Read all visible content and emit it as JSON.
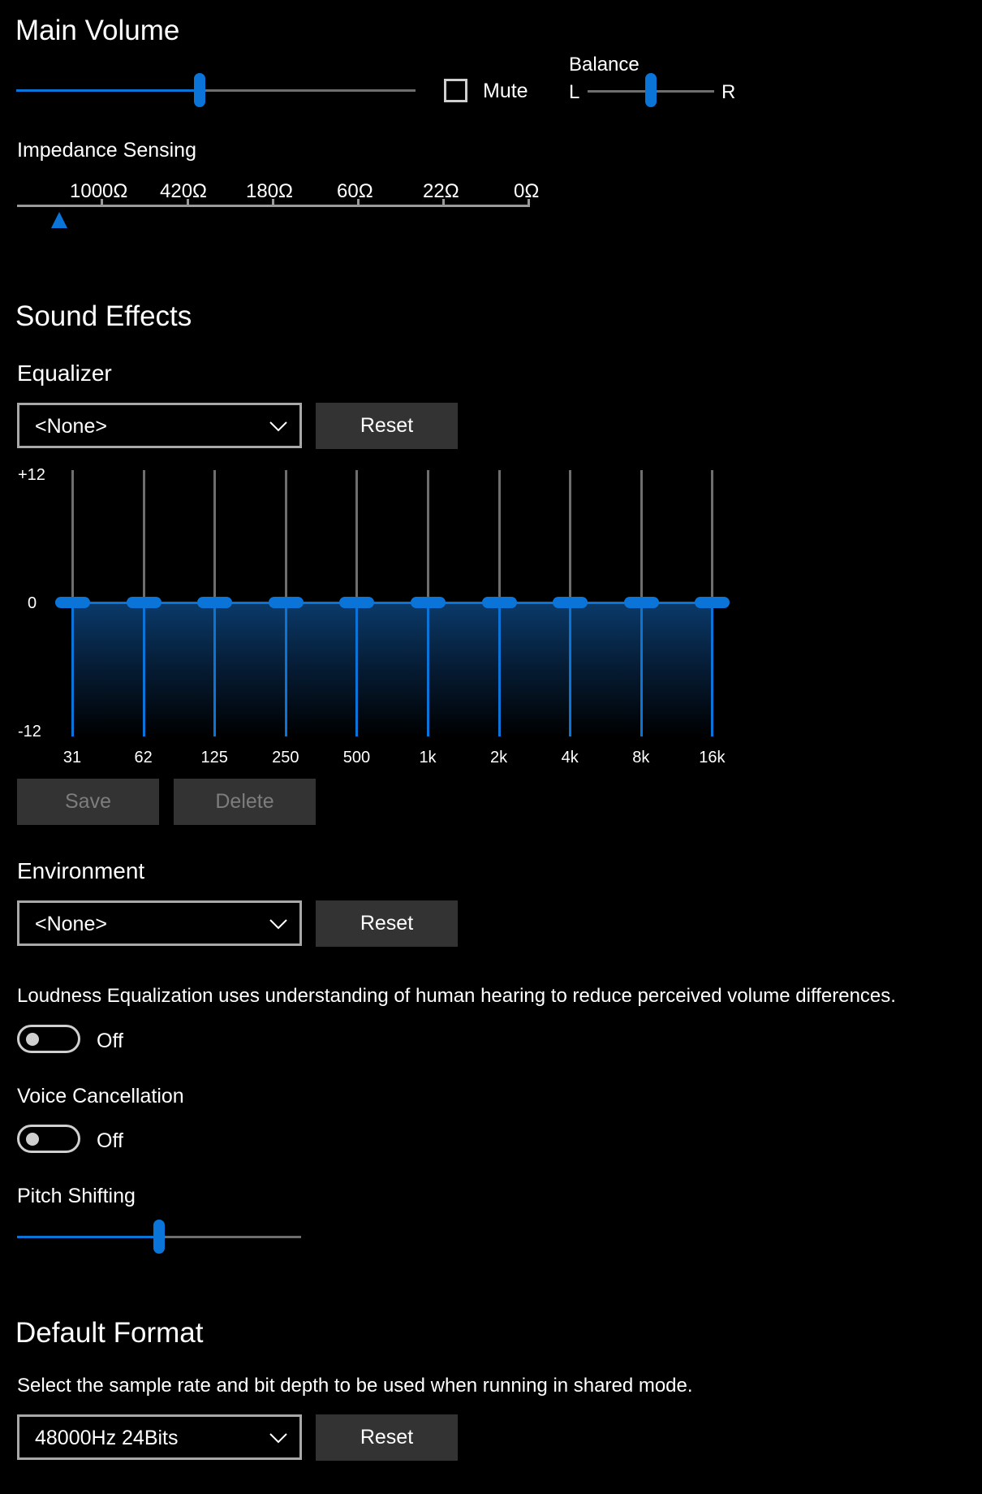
{
  "main_volume": {
    "title": "Main Volume",
    "volume_percent": 46,
    "mute_label": "Mute",
    "mute_checked": false,
    "balance_label": "Balance",
    "balance_left": "L",
    "balance_right": "R",
    "balance_percent": 50
  },
  "impedance": {
    "title": "Impedance Sensing",
    "scale": [
      "1000Ω",
      "420Ω",
      "180Ω",
      "60Ω",
      "22Ω",
      "0Ω"
    ],
    "marker_label": "▲"
  },
  "sound_effects": {
    "title": "Sound Effects",
    "equalizer": {
      "label": "Equalizer",
      "preset": "<None>",
      "reset_label": "Reset",
      "y_max_label": "+12",
      "y_zero_label": "0",
      "y_min_label": "-12",
      "bands": [
        "31",
        "62",
        "125",
        "250",
        "500",
        "1k",
        "2k",
        "4k",
        "8k",
        "16k"
      ],
      "gains_db": [
        0,
        0,
        0,
        0,
        0,
        0,
        0,
        0,
        0,
        0
      ],
      "save_label": "Save",
      "delete_label": "Delete"
    },
    "environment": {
      "label": "Environment",
      "preset": "<None>",
      "reset_label": "Reset"
    },
    "loudness": {
      "description": "Loudness Equalization uses understanding of human hearing to reduce perceived volume differences.",
      "state": "Off"
    },
    "voice_cancellation": {
      "label": "Voice Cancellation",
      "state": "Off"
    },
    "pitch_shifting": {
      "label": "Pitch Shifting",
      "value_percent": 50
    }
  },
  "default_format": {
    "title": "Default Format",
    "description": "Select the sample rate and bit depth to be used when running in shared mode.",
    "value": "48000Hz 24Bits",
    "reset_label": "Reset"
  },
  "colors": {
    "accent": "#0a74d8",
    "background": "#000000",
    "button": "#333333"
  }
}
